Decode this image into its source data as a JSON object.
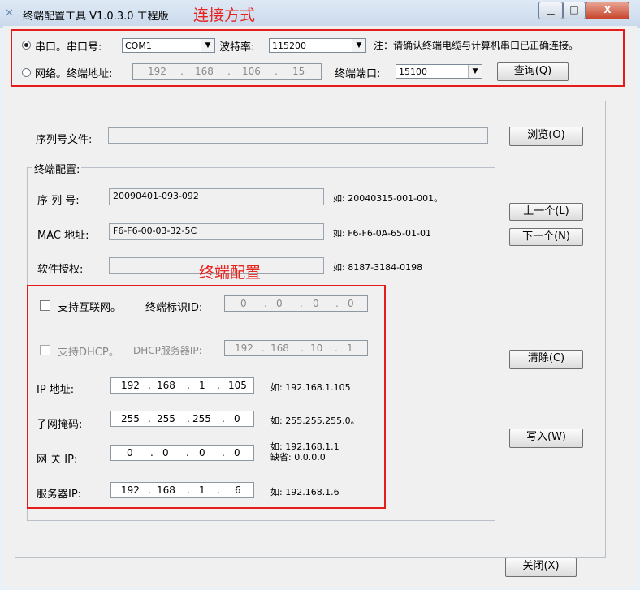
{
  "window": {
    "title": "终端配置工具 V1.0.3.0 工程版",
    "annotation_connect": "连接方式",
    "min_label": "▁",
    "max_label": "□",
    "close_label": "X"
  },
  "connection": {
    "serial_label": "串口。串口号:",
    "serial_port": "COM1",
    "baud_label": "波特率:",
    "baud_rate": "115200",
    "note": "注：请确认终端电缆与计算机串口已正确连接。",
    "network_label": "网络。终端地址:",
    "terminal_ip": [
      "192",
      "168",
      "106",
      "15"
    ],
    "port_label": "终端端口:",
    "port_value": "15100",
    "query_button": "查询(Q)"
  },
  "serial_file": {
    "label": "序列号文件:",
    "value": "",
    "browse_button": "浏览(O)"
  },
  "terminal_group": {
    "legend": "终端配置:",
    "annotation": "终端配置",
    "serial_no_label": "序 列 号:",
    "serial_no_value": "20090401-093-092",
    "serial_no_example": "如: 20040315-001-001。",
    "mac_label": "MAC 地址:",
    "mac_value": "F6-F6-00-03-32-5C",
    "mac_example": "如: F6-F6-0A-65-01-01",
    "license_label": "软件授权:",
    "license_value": "",
    "license_example": "如: 8187-3184-0198"
  },
  "network_settings": {
    "internet_label": "支持互联网。",
    "terminal_id_label": "终端标识ID:",
    "terminal_id": [
      "0",
      "0",
      "0",
      "0"
    ],
    "dhcp_label": "支持DHCP。",
    "dhcp_server_label": "DHCP服务器IP:",
    "dhcp_server_ip": [
      "192",
      "168",
      "10",
      "1"
    ],
    "ip_label": "IP  地址:",
    "ip_value": [
      "192",
      "168",
      "1",
      "105"
    ],
    "ip_example": "如: 192.168.1.105",
    "mask_label": "子网掩码:",
    "mask_value": [
      "255",
      "255",
      "255",
      "0"
    ],
    "mask_example": "如: 255.255.255.0。",
    "gateway_label": "网 关 IP:",
    "gateway_value": [
      "0",
      "0",
      "0",
      "0"
    ],
    "gateway_example_1": "如: 192.168.1.1",
    "gateway_example_2": "缺省: 0.0.0.0",
    "server_label": "服务器IP:",
    "server_value": [
      "192",
      "168",
      "1",
      "6"
    ],
    "server_example": "如: 192.168.1.6"
  },
  "buttons": {
    "prev": "上一个(L)",
    "next": "下一个(N)",
    "clear": "清除(C)",
    "write": "写入(W)",
    "close": "关闭(X)"
  }
}
